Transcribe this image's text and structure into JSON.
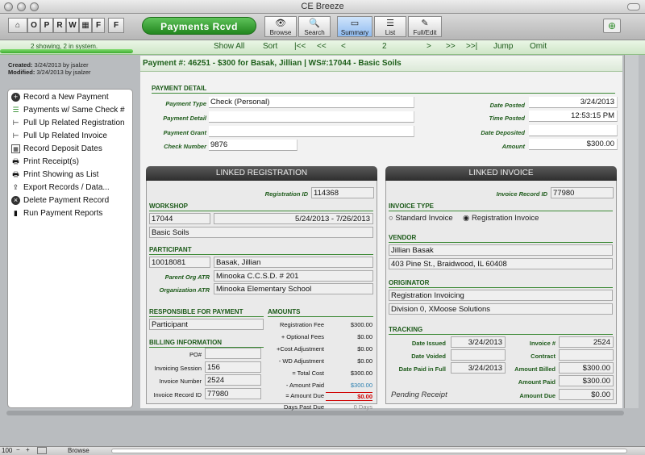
{
  "window": {
    "title": "CE Breeze"
  },
  "toolbar": {
    "nav_buttons": [
      "O",
      "P",
      "R",
      "W",
      "F"
    ],
    "layout_title": "Payments Rcvd",
    "modes": [
      {
        "label": "Browse",
        "icon": "eye-icon"
      },
      {
        "label": "Search",
        "icon": "magnifier-icon"
      },
      {
        "label": "Summary",
        "icon": "summary-icon"
      },
      {
        "label": "List",
        "icon": "list-icon"
      },
      {
        "label": "Full/Edit",
        "icon": "edit-icon"
      }
    ]
  },
  "navbar": {
    "found_count": "2 showing, 2 in system.",
    "show_all": "Show All",
    "sort": "Sort",
    "first": "|<<",
    "prev_fast": "<<",
    "prev": "<",
    "record_number": "2",
    "next": ">",
    "next_fast": ">>",
    "last": ">>|",
    "jump": "Jump",
    "omit": "Omit"
  },
  "meta": {
    "created_label": "Created:",
    "created_value": "3/24/2013 by jsalzer",
    "modified_label": "Modified:",
    "modified_value": "3/24/2013 by jsalzer"
  },
  "sidebar": {
    "items": [
      {
        "label": "Record a New Payment",
        "icon": "plus-circle-icon"
      },
      {
        "label": "Payments w/ Same Check #",
        "icon": "list-icon"
      },
      {
        "label": "Pull Up Related Registration",
        "icon": "branch-icon"
      },
      {
        "label": "Pull Up Related Invoice",
        "icon": "branch-icon"
      },
      {
        "label": "Record Deposit Dates",
        "icon": "calendar-icon"
      },
      {
        "label": "Print Receipt(s)",
        "icon": "printer-icon"
      },
      {
        "label": "Print Showing as List",
        "icon": "printer-icon"
      },
      {
        "label": "Export Records / Data...",
        "icon": "export-icon"
      },
      {
        "label": "Delete Payment Record",
        "icon": "delete-circle-icon"
      },
      {
        "label": "Run Payment Reports",
        "icon": "bar-chart-icon"
      }
    ]
  },
  "header": {
    "text": "Payment #: 46251 - $300 for Basak, Jillian  |  WS#:17044 - Basic Soils"
  },
  "payment_detail": {
    "section": "PAYMENT DETAIL",
    "payment_type_label": "Payment Type",
    "payment_type": "Check (Personal)",
    "payment_detail_label": "Payment Detail",
    "payment_detail": "",
    "payment_grant_label": "Payment Grant",
    "payment_grant": "",
    "check_number_label": "Check Number",
    "check_number": "9876",
    "date_posted_label": "Date Posted",
    "date_posted": "3/24/2013",
    "time_posted_label": "Time Posted",
    "time_posted": "12:53:15 PM",
    "date_deposited_label": "Date Deposited",
    "date_deposited": "",
    "amount_label": "Amount",
    "amount": "$300.00"
  },
  "registration": {
    "title": "LINKED REGISTRATION",
    "reg_id_label": "Registration ID",
    "reg_id": "114368",
    "workshop_section": "WORKSHOP",
    "workshop_id": "17044",
    "workshop_dates": "5/24/2013 - 7/26/2013",
    "workshop_name": "Basic Soils",
    "participant_section": "PARTICIPANT",
    "participant_id": "10018081",
    "participant_name": "Basak, Jillian",
    "parent_org_label": "Parent Org ATR",
    "parent_org": "Minooka C.C.S.D. # 201",
    "organization_label": "Organization ATR",
    "organization": "Minooka Elementary School",
    "responsible_section": "RESPONSIBLE FOR PAYMENT",
    "responsible": "Participant",
    "billing_section": "BILLING INFORMATION",
    "po_label": "PO#",
    "po": "",
    "session_label": "Invoicing Session",
    "session": "156",
    "invoice_number_label": "Invoice Number",
    "invoice_number": "2524",
    "invoice_record_label": "Invoice Record ID",
    "invoice_record": "77980",
    "amounts_section": "AMOUNTS",
    "amounts": [
      {
        "label": "Registration Fee",
        "value": "$300.00"
      },
      {
        "label": "+ Optional Fees",
        "value": "$0.00"
      },
      {
        "label": "+Cost Adjustment",
        "value": "$0.00"
      },
      {
        "label": "- WD Adjustment",
        "value": "$0.00"
      },
      {
        "label": "= Total Cost",
        "value": "$300.00"
      },
      {
        "label": "- Amount Paid",
        "value": "$300.00"
      },
      {
        "label": "= Amount Due",
        "value": "$0.00"
      },
      {
        "label": "Days Past Due",
        "value": "0 Days"
      }
    ]
  },
  "invoice": {
    "title": "LINKED INVOICE",
    "record_id_label": "Invoice Record ID",
    "record_id": "77980",
    "type_section": "INVOICE TYPE",
    "type_standard": "Standard Invoice",
    "type_registration": "Registration Invoice",
    "vendor_section": "VENDOR",
    "vendor_name": "Jillian Basak",
    "vendor_address": "403 Pine St., Braidwood, IL  60408",
    "originator_section": "ORIGINATOR",
    "originator_1": "Registration Invoicing",
    "originator_2": "Division 0, XMoose Solutions",
    "tracking_section": "TRACKING",
    "date_issued_label": "Date Issued",
    "date_issued": "3/24/2013",
    "date_voided_label": "Date Voided",
    "date_voided": "",
    "date_paid_label": "Date Paid in Full",
    "date_paid": "3/24/2013",
    "invoice_no_label": "Invoice #",
    "invoice_no": "2524",
    "contract_label": "Contract",
    "contract": "",
    "amount_billed_label": "Amount Billed",
    "amount_billed": "$300.00",
    "amount_paid_label": "Amount Paid",
    "amount_paid": "$300.00",
    "amount_due_label": "Amount Due",
    "amount_due": "$0.00",
    "status": "Pending Receipt"
  },
  "statusbar": {
    "zoom": "100",
    "mode": "Browse"
  },
  "colors": {
    "accent_green": "#2e8b2a",
    "amount_paid": "#2a7fb0",
    "amount_due": "#d00000"
  }
}
